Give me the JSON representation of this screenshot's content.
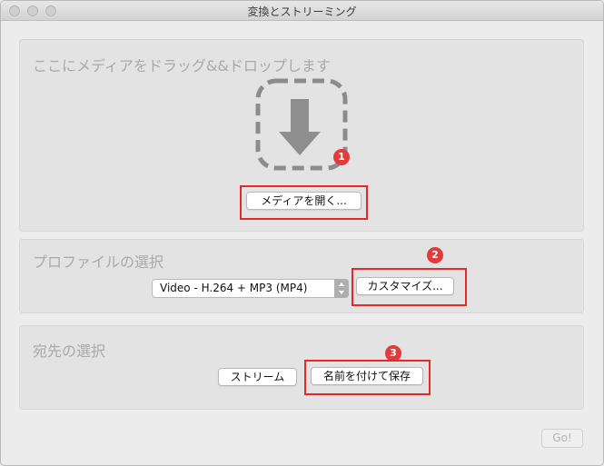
{
  "window": {
    "title": "変換とストリーミング"
  },
  "drop_section": {
    "title": "ここにメディアをドラッグ&&ドロップします",
    "open_button": "メディアを開く..."
  },
  "profile_section": {
    "title": "プロファイルの選択",
    "selected_profile": "Video - H.264 + MP3 (MP4)",
    "customize_button": "カスタマイズ..."
  },
  "destination_section": {
    "title": "宛先の選択",
    "stream_button": "ストリーム",
    "save_as_button": "名前を付けて保存"
  },
  "go_button": "Go!",
  "annotations": {
    "marker1": "1",
    "marker2": "2",
    "marker3": "3",
    "color": "#e32a2a"
  }
}
